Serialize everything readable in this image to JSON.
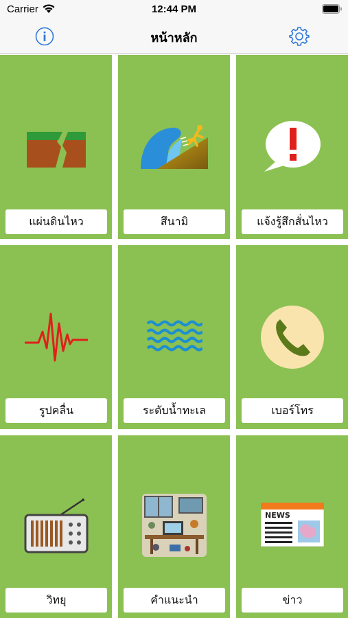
{
  "status_bar": {
    "carrier": "Carrier",
    "time": "12:44 PM"
  },
  "nav": {
    "title": "หน้าหลัก",
    "left_icon": "info-icon",
    "right_icon": "gear-icon"
  },
  "colors": {
    "tile_green": "#8bc152",
    "accent_blue": "#2f7ad9"
  },
  "tiles": [
    {
      "label": "แผ่นดินไหว",
      "icon": "earthquake-icon"
    },
    {
      "label": "สึนามิ",
      "icon": "tsunami-icon"
    },
    {
      "label": "แจ้งรู้สึกสั่นไหว",
      "icon": "alert-bubble-icon"
    },
    {
      "label": "รูปคลื่น",
      "icon": "waveform-icon"
    },
    {
      "label": "ระดับน้ำทะเล",
      "icon": "sea-level-icon"
    },
    {
      "label": "เบอร์โทร",
      "icon": "phone-icon"
    },
    {
      "label": "วิทยุ",
      "icon": "radio-icon"
    },
    {
      "label": "คำแนะนำ",
      "icon": "advice-icon"
    },
    {
      "label": "ข่าว",
      "icon": "news-icon"
    }
  ],
  "news_icon_text": "NEWS"
}
